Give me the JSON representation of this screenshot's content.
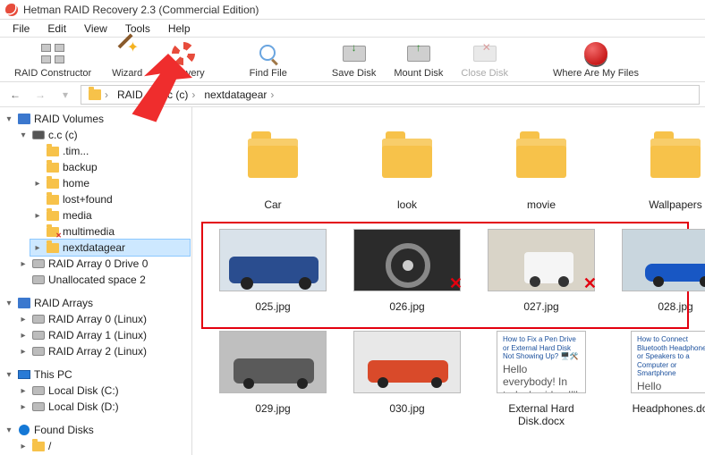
{
  "titlebar": {
    "title": "Hetman RAID Recovery 2.3 (Commercial Edition)"
  },
  "menus": {
    "file": "File",
    "edit": "Edit",
    "view": "View",
    "tools": "Tools",
    "help": "Help"
  },
  "toolbar": {
    "raid": "RAID Constructor",
    "wizard": "Wizard",
    "recovery": "Recovery",
    "find": "Find File",
    "save": "Save Disk",
    "mount": "Mount Disk",
    "close": "Close Disk",
    "where": "Where Are My Files"
  },
  "breadcrumb": {
    "seg0": "RAID",
    "seg1": "c.c (c)",
    "seg2": "nextdatagear"
  },
  "tree": {
    "raid_volumes": "RAID Volumes",
    "cc": "c.c (c)",
    "timb": ".tim...",
    "backup": "backup",
    "home": "home",
    "lostfound": "lost+found",
    "media": "media",
    "multimedia": "multimedia",
    "nextdatagear": "nextdatagear",
    "array0d0": "RAID Array 0 Drive 0",
    "unalloc": "Unallocated space 2",
    "raid_arrays": "RAID Arrays",
    "ra0": "RAID Array 0 (Linux)",
    "ra1": "RAID Array 1 (Linux)",
    "ra2": "RAID Array 2 (Linux)",
    "this_pc": "This PC",
    "localc": "Local Disk (C:)",
    "locald": "Local Disk (D:)",
    "found_disks": "Found Disks",
    "slash": "/"
  },
  "grid": {
    "folders": {
      "car": "Car",
      "look": "look",
      "movie": "movie",
      "wallpapers": "Wallpapers"
    },
    "r2": {
      "a": "025.jpg",
      "b": "026.jpg",
      "c": "027.jpg",
      "d": "028.jpg"
    },
    "r3": {
      "a": "029.jpg",
      "b": "030.jpg",
      "c": "External Hard Disk.docx",
      "d": "Headphones.docx",
      "doc1_title": "How to Fix a Pen Drive or External Hard Disk Not Showing Up? 🖥️🛠️",
      "doc1_body": "Hello everybody! In today's video I'll tell you what to do if an",
      "doc2_title": "How to Connect Bluetooth Headphones or Speakers to a Computer or Smartphone",
      "doc2_body": "Hello everybody! In"
    }
  },
  "colors": {
    "car025": "#2a4d8f",
    "car026": "#3b3b3b",
    "car027": "#d9d4c8",
    "car028": "#8aa7c4",
    "car029": "#5a5a5a",
    "car030": "#d94a2a"
  }
}
